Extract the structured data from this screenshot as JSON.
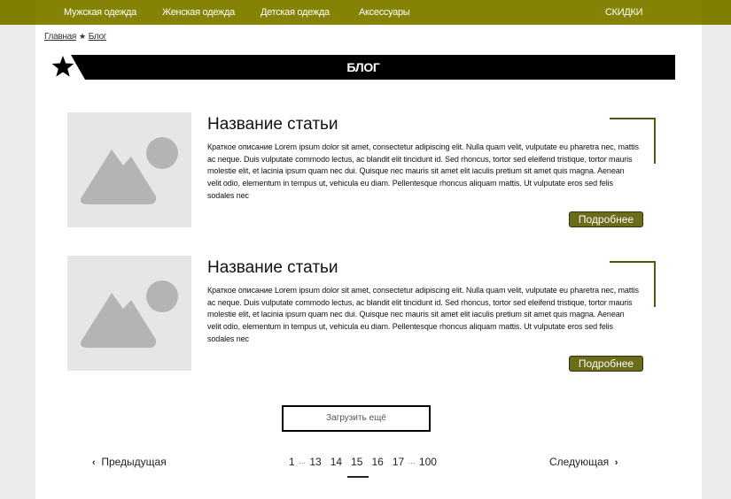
{
  "nav": {
    "items": [
      "Мужская одежда",
      "Женская одежда",
      "Детская одежда",
      "Аксессуары"
    ],
    "sale": "СКИДКИ"
  },
  "breadcrumb": {
    "home": "Главная",
    "separator": "★",
    "current": "Блог"
  },
  "banner": {
    "title": "БЛОГ",
    "icon": "star-icon"
  },
  "articles": [
    {
      "title": "Название статьи",
      "text": "Краткое описание Lorem ipsum dolor sit amet, consectetur adipiscing elit. Nulla quam velit, vulputate eu pharetra nec, mattis ac neque. Duis vulputate commodo lectus, ac blandit elit tincidunt id. Sed rhoncus, tortor sed eleifend tristique, tortor mauris molestie elit, et lacinia ipsum quam nec dui. Quisque nec mauris sit amet elit iaculis pretium sit amet quis magna. Aenean velit odio, elementum in tempus ut, vehicula eu diam. Pellentesque rhoncus aliquam mattis. Ut vulputate eros sed felis sodales nec",
      "button": "Подробнее",
      "image_icon": "image-placeholder-icon"
    },
    {
      "title": "Название статьи",
      "text": "Краткое описание Lorem ipsum dolor sit amet, consectetur adipiscing elit. Nulla quam velit, vulputate eu pharetra nec, mattis ac neque. Duis vulputate commodo lectus, ac blandit elit tincidunt id. Sed rhoncus, tortor sed eleifend tristique, tortor mauris molestie elit, et lacinia ipsum quam nec dui. Quisque nec mauris sit amet elit iaculis pretium sit amet quis magna. Aenean velit odio, elementum in tempus ut, vehicula eu diam. Pellentesque rhoncus aliquam mattis. Ut vulputate eros sed felis sodales nec",
      "button": "Подробнее",
      "image_icon": "image-placeholder-icon"
    }
  ],
  "load_more": "Загрузить ещё",
  "pagination": {
    "prev": "Предыдущая",
    "next": "Следующая",
    "first": "1",
    "ellipsis": "···",
    "pages": [
      "13",
      "14",
      "15",
      "16",
      "17"
    ],
    "last": "100",
    "current": "15"
  },
  "colors": {
    "accent": "#808000",
    "button": "#6b6b19",
    "corner": "#525a11"
  }
}
